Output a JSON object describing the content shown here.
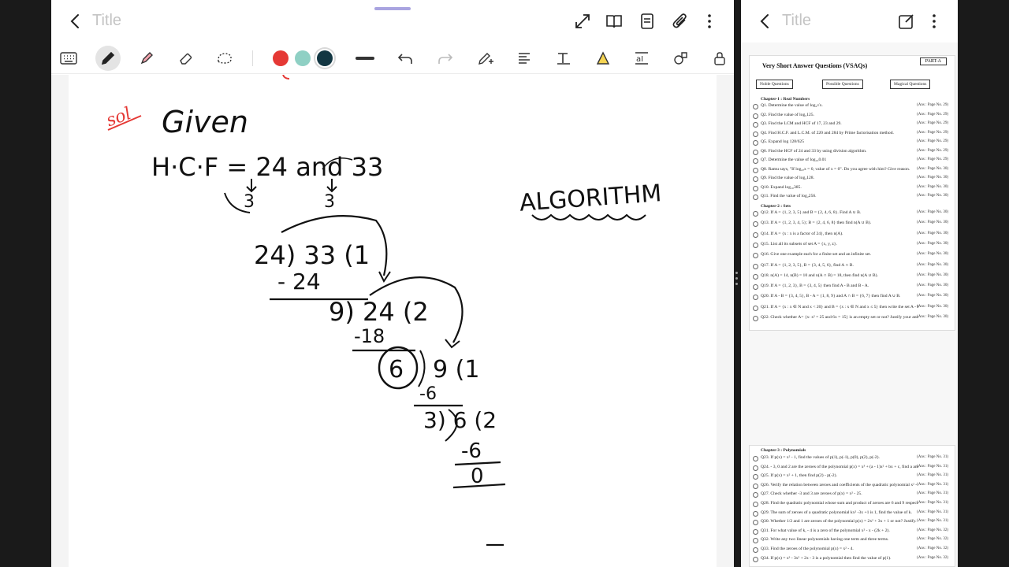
{
  "left_window": {
    "title": "Title",
    "tools": [
      "keyboard-icon",
      "pen-icon",
      "highlighter-icon",
      "eraser-icon",
      "lasso-icon"
    ],
    "colors": [
      "#e53935",
      "#8fd0c4",
      "#123642"
    ],
    "selected_color": "#123642",
    "extra_tools": [
      "line-thickness-icon",
      "undo-icon",
      "redo-icon",
      "pen-settings-icon",
      "text-align-icon",
      "handwriting-to-text-icon",
      "smart-shape-icon",
      "text-box-icon",
      "shapes-icon",
      "lock-icon"
    ]
  },
  "handwriting": {
    "sol": "sol",
    "given": "Given",
    "hcf_line": "H·C·F = 24 and 33",
    "arrow_a": "3",
    "arrow_b": "3",
    "algorithm": "ALGORITHM",
    "step1": "24) 33 (1",
    "step1_sub": "- 24",
    "step2": "9) 24 (2",
    "step2_sub": "-18",
    "step3_div": "6",
    "step3": "9 (1",
    "step3_sub": "-6",
    "step4": "3) 6 (2",
    "step4_sub": "-6",
    "step4_rem": "0"
  },
  "right_window": {
    "title": "Title",
    "doc": {
      "part": "PART-A",
      "heading": "Very Short Answer Questions (VSAQs)",
      "tabs": [
        "Noble Questions",
        "Possible Questions",
        "Magical Questions"
      ],
      "chapter1": "Chapter-1 : Real Numbers",
      "questions1": [
        {
          "q": "Q1. Determine the value of log₂√x.",
          "a": "(Ans : Page No. 29)"
        },
        {
          "q": "Q2. Find the value of log₅125.",
          "a": "(Ans : Page No. 29)"
        },
        {
          "q": "Q3. Find the LCM and HCF of 17, 23 and 29.",
          "a": "(Ans : Page No. 29)"
        },
        {
          "q": "Q4. Find H.C.F. and L.C.M. of 220 and 284 by Prime factorisation method.",
          "a": "(Ans : Page No. 29)"
        },
        {
          "q": "Q5. Expand log 128/625",
          "a": "(Ans : Page No. 29)"
        },
        {
          "q": "Q6. Find the HCF of 24 and 33 by using division algorithm.",
          "a": "(Ans : Page No. 29)"
        },
        {
          "q": "Q7. Determine the value of log₁₀0.01",
          "a": "(Ans : Page No. 29)"
        },
        {
          "q": "Q8. Ramu says, \"If log₂ₓx = 0, value of x = 0\". Do you agree with him? Give reason.",
          "a": "(Ans : Page No. 30)"
        },
        {
          "q": "Q9. Find the value of log₂128.",
          "a": "(Ans : Page No. 30)"
        },
        {
          "q": "Q10. Expand log₁₀385.",
          "a": "(Ans : Page No. 30)"
        },
        {
          "q": "Q11. Find the value of log₂256.",
          "a": "(Ans : Page No. 30)"
        }
      ],
      "chapter2": "Chapter-2 : Sets",
      "questions2": [
        {
          "q": "Q12. If A = {1, 2, 3, 5} and B = {2, 4, 6, 8}. Find A ∪ B.",
          "a": "(Ans : Page No. 30)"
        },
        {
          "q": "Q13. If A = {1, 2, 3, 4, 5}; B = {2, 4, 6, 8} then find n(A ∪ B).",
          "a": "(Ans : Page No. 30)"
        },
        {
          "q": "Q14. If A = {x : x is a factor of 24}, then n(A).",
          "a": "(Ans : Page No. 30)"
        },
        {
          "q": "Q15. List all its subsets of set A = {x, y, z}.",
          "a": "(Ans : Page No. 30)"
        },
        {
          "q": "Q16. Give one example each for a finite set and an infinite set.",
          "a": "(Ans : Page No. 30)"
        },
        {
          "q": "Q17. If A = {1, 2, 3, 5}, B = {3, 4, 5, 6}, find A ∩ B.",
          "a": "(Ans : Page No. 30)"
        },
        {
          "q": "Q18. n(A) = 14, n(B) = 10 and n(A ∩ B) = 18, then find n(A ∪ B).",
          "a": "(Ans : Page No. 30)"
        },
        {
          "q": "Q19. If A = {1, 2, 3}, B = {3, 4, 5} then find A - B and B - A.",
          "a": "(Ans : Page No. 30)"
        },
        {
          "q": "Q20. If A - B = {3, 4, 5}, B - A = {1, 8, 9} and A ∩ B = {6, 7} then find A ∪ B.",
          "a": "(Ans : Page No. 30)"
        },
        {
          "q": "Q21. If A = {x : x ∈ N and x < 20} and B = {x : x ∈ N and x ≤ 5} then write the set A - B in the set builder form.",
          "a": "(Ans : Page No. 30)"
        },
        {
          "q": "Q22. Check whether A= {x: x² = 25 and 6x = 15} is an empty set or not? Justify your answer.",
          "a": "(Ans : Page No. 30)"
        }
      ],
      "chapter3": "Chapter-3 : Polynomials",
      "questions3": [
        {
          "q": "Q23. If p(x) = x² - 1, find the values of p(1), p(-1), p(0), p(2), p(-2).",
          "a": "(Ans : Page No. 31)"
        },
        {
          "q": "Q24. - 3, 0 and 2 are the zeroes of the polynomial p(x) = x³ + (a - 1)x² + bx + c, find a and c.",
          "a": "(Ans : Page No. 31)"
        },
        {
          "q": "Q25. If p(x) = x² + 1, then find p(2) - p(-2).",
          "a": "(Ans : Page No. 31)"
        },
        {
          "q": "Q26. Verify the relation between zeroes and coefficients of the quadratic polynomial x² - 4.",
          "a": "(Ans : Page No. 31)"
        },
        {
          "q": "Q27. Check whether -3 and 3 are zeroes of p(x) = x² - 25.",
          "a": "(Ans : Page No. 31)"
        },
        {
          "q": "Q28. Find the quadratic polynomial whose sum and product of zeroes are 6 and 9 respectively.",
          "a": "(Ans : Page No. 31)"
        },
        {
          "q": "Q29. The sum of zeroes of a quadratic polynomial kx² -3x +1 is 1, find the value of k.",
          "a": "(Ans : Page No. 31)"
        },
        {
          "q": "Q30. Whether 1/2 and 1 are zeroes of the polynomial p(x) = 2x² + 3x + 1 or not? Justify.",
          "a": "(Ans : Page No. 31)"
        },
        {
          "q": "Q31. For what value of k, - 4 is a zero of the polynomial x² - x - (2k + 2).",
          "a": "(Ans : Page No. 32)"
        },
        {
          "q": "Q32. Write any two linear polynomials having one term and three terms.",
          "a": "(Ans : Page No. 32)"
        },
        {
          "q": "Q33. Find the zeroes of the polynomial p(x) = x² - 4.",
          "a": "(Ans : Page No. 32)"
        },
        {
          "q": "Q34. If p(x) = x³ - 3x² + 2x - 3 is a polynomial then find the value of p(1).",
          "a": "(Ans : Page No. 32)"
        }
      ]
    }
  }
}
